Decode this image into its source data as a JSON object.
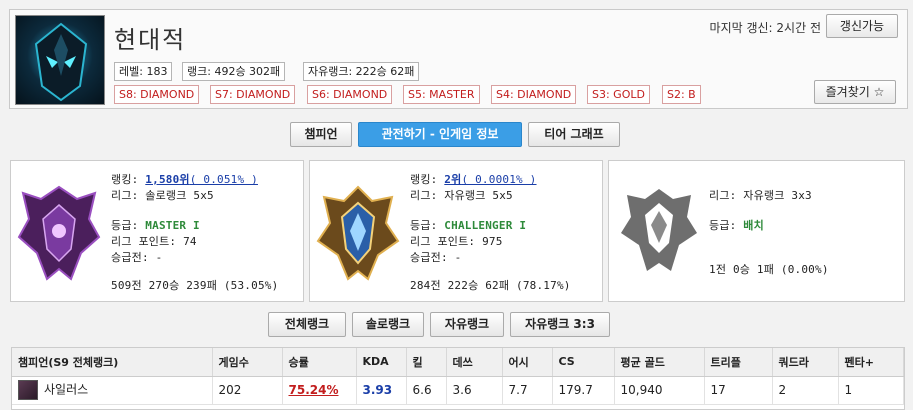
{
  "profile": {
    "name": "현대적",
    "level": "레벨: 183",
    "rank_record": "랭크: 492승 302패",
    "flex_record": "자유랭크: 222승 62패",
    "seasons": [
      "S8: DIAMOND",
      "S7: DIAMOND",
      "S6: DIAMOND",
      "S5: MASTER",
      "S4: DIAMOND",
      "S3: GOLD",
      "S2: B"
    ],
    "last_update": "마지막 갱신: 2시간 전",
    "update_button": "갱신가능",
    "favorite_button": "즐겨찾기 ☆"
  },
  "tabs": [
    "챔피언",
    "관전하기 - 인게임 정보",
    "티어 그래프"
  ],
  "panels": [
    {
      "rank_label": "랭킹:",
      "rank_value": "1,580위",
      "rank_pct": "( 0.051% )",
      "league": "리그: 솔로랭크 5x5",
      "tier_label": "등급:",
      "tier": "MASTER I",
      "points": "리그 포인트: 74",
      "promo": "승급전: -",
      "record": "509전 270승 239패 (53.05%)"
    },
    {
      "rank_label": "랭킹:",
      "rank_value": "2위",
      "rank_pct": "( 0.0001% )",
      "league": "리그: 자유랭크 5x5",
      "tier_label": "등급:",
      "tier": "CHALLENGER I",
      "points": "리그 포인트: 975",
      "promo": "승급전: -",
      "record": "284전 222승 62패 (78.17%)"
    },
    {
      "league": "리그: 자유랭크 3x3",
      "tier_label": "등급:",
      "tier": "배치",
      "record": "1전 0승 1패 (0.00%)"
    }
  ],
  "subtabs": [
    "전체랭크",
    "솔로랭크",
    "자유랭크",
    "자유랭크 3:3"
  ],
  "table": {
    "headers": [
      "챔피언(S9 전체랭크)",
      "게임수",
      "승률",
      "KDA",
      "킬",
      "데쓰",
      "어시",
      "CS",
      "평균 골드",
      "트리플",
      "쿼드라",
      "펜타+"
    ],
    "rows": [
      [
        "사일러스",
        "202",
        "75.24%",
        "3.93",
        "6.6",
        "3.6",
        "7.7",
        "179.7",
        "10,940",
        "17",
        "2",
        "1"
      ]
    ]
  },
  "colors": {
    "active_tab": "#3b9ee6",
    "tier_green": "#2e8a3a",
    "season_red": "#c21d1d",
    "link_blue": "#1a3ea8"
  }
}
